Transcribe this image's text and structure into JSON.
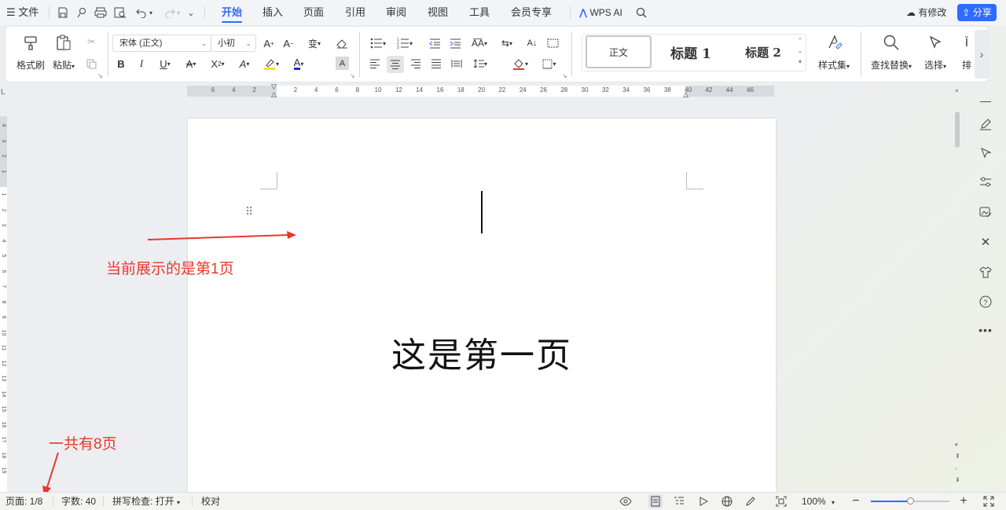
{
  "menubar": {
    "file_label": "文件",
    "tabs": [
      {
        "label": "开始",
        "active": true
      },
      {
        "label": "插入",
        "active": false
      },
      {
        "label": "页面",
        "active": false
      },
      {
        "label": "引用",
        "active": false
      },
      {
        "label": "审阅",
        "active": false
      },
      {
        "label": "视图",
        "active": false
      },
      {
        "label": "工具",
        "active": false
      },
      {
        "label": "会员专享",
        "active": false
      }
    ],
    "wps_ai_label": "WPS AI",
    "modified_label": "有修改",
    "share_label": "分享",
    "accent_color": "#2f6bff"
  },
  "ribbon": {
    "format_painter_label": "格式刷",
    "paste_label": "粘贴",
    "font_name": "宋体 (正文)",
    "font_size": "小初",
    "styles": {
      "normal": "正文",
      "heading1": "标题 1",
      "heading2": "标题 2"
    },
    "style_set_label": "样式集",
    "find_replace_label": "查找替换",
    "select_label": "选择",
    "sort_label": "排"
  },
  "ruler": {
    "ticks": [
      "6",
      "4",
      "2",
      "2",
      "4",
      "6",
      "8",
      "10",
      "12",
      "14",
      "16",
      "18",
      "20",
      "22",
      "24",
      "26",
      "28",
      "30",
      "32",
      "34",
      "36",
      "38",
      "40",
      "42",
      "44",
      "46"
    ]
  },
  "vruler": {
    "ticks": [
      "4",
      "3",
      "2",
      "1",
      "1",
      "2",
      "3",
      "4",
      "5",
      "6",
      "7",
      "8",
      "9",
      "10",
      "11",
      "12",
      "13",
      "14",
      "15",
      "16",
      "17",
      "18",
      "19"
    ]
  },
  "document": {
    "body_text": "这是第一页"
  },
  "annotations": {
    "current_page_note": "当前展示的是第1页",
    "total_pages_note": "一共有8页",
    "arrow_color": "#e8372c"
  },
  "statusbar": {
    "page_indicator": "页面: 1/8",
    "word_count": "字数: 40",
    "spell_check": "拼写检查: 打开",
    "proofread": "校对",
    "zoom": "100%",
    "zoom_level": 0.5
  }
}
